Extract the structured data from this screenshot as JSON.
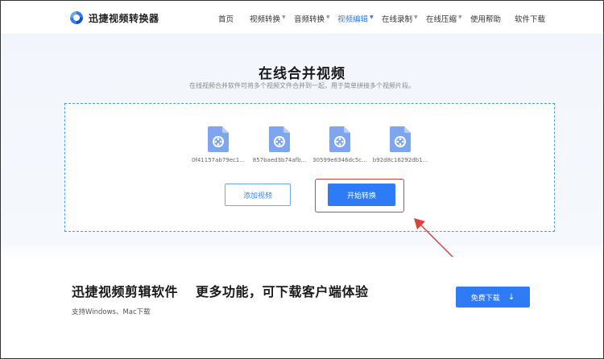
{
  "header": {
    "logo_text": "迅捷视频转换器",
    "nav": [
      {
        "label": "首页",
        "dropdown": false,
        "active": false
      },
      {
        "label": "视频转换",
        "dropdown": true,
        "active": false
      },
      {
        "label": "音频转换",
        "dropdown": true,
        "active": false
      },
      {
        "label": "视频编辑",
        "dropdown": true,
        "active": true
      },
      {
        "label": "在线录制",
        "dropdown": true,
        "active": false
      },
      {
        "label": "在线压缩",
        "dropdown": true,
        "active": false
      },
      {
        "label": "使用帮助",
        "dropdown": false,
        "active": false
      },
      {
        "label": "软件下载",
        "dropdown": false,
        "active": false
      }
    ]
  },
  "main": {
    "title": "在线合并视频",
    "subtitle": "在线视频合并软件可将多个视频文件合并到一起，用于简单拼接多个视频片段。",
    "files": [
      {
        "name": "0f41157ab79ec1..."
      },
      {
        "name": "857baed3b74afb..."
      },
      {
        "name": "30599e6346dc5c..."
      },
      {
        "name": "b92d8c16292db1..."
      }
    ],
    "add_button": "添加视频",
    "start_button": "开始转换"
  },
  "promo": {
    "title_left": "迅捷视频剪辑软件",
    "title_right": "更多功能，可下载客户端体验",
    "subtitle": "支持Windows、Mac下载",
    "download_button": "免费下载",
    "download_icon": "↓"
  },
  "colors": {
    "accent": "#2e7bf5",
    "highlight": "#e0403a",
    "file_icon": "#7ea6ee"
  }
}
